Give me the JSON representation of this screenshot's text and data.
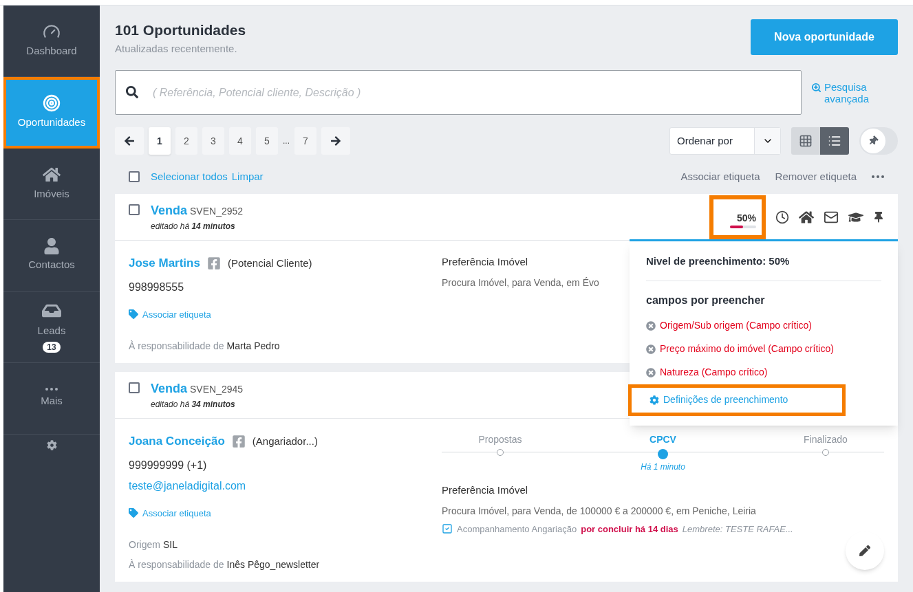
{
  "sidebar": {
    "items": [
      {
        "label": "Dashboard",
        "kind": "gauge",
        "selected": false,
        "highlighted": false
      },
      {
        "label": "Oportunidades",
        "kind": "target",
        "selected": true,
        "highlighted": true
      },
      {
        "label": "Imóveis",
        "kind": "house",
        "selected": false,
        "highlighted": false
      },
      {
        "label": "Contactos",
        "kind": "user",
        "selected": false,
        "highlighted": false
      },
      {
        "label": "Leads",
        "kind": "inbox",
        "selected": false,
        "highlighted": false,
        "badge": "13"
      },
      {
        "label": "Mais",
        "kind": "dots",
        "selected": false,
        "highlighted": false
      }
    ]
  },
  "header": {
    "title": "101 Oportunidades",
    "subtitle": "Atualizadas recentemente.",
    "new_button": "Nova oportunidade"
  },
  "search": {
    "placeholder": "( Referência, Potencial cliente, Descrição )",
    "advanced_link": "Pesquisa avançada"
  },
  "pagination": {
    "pages": [
      {
        "label": "1",
        "selected": true
      },
      {
        "label": "2",
        "selected": false
      },
      {
        "label": "3",
        "selected": false
      },
      {
        "label": "4",
        "selected": false
      },
      {
        "label": "5",
        "selected": false
      },
      {
        "label": "...",
        "kind": "ellipsis"
      },
      {
        "label": "7",
        "selected": false
      }
    ]
  },
  "sort": {
    "label": "Ordenar por"
  },
  "view": {
    "options": [
      {
        "kind": "grid",
        "selected": false
      },
      {
        "kind": "list",
        "selected": true
      }
    ]
  },
  "pin_toggle": {
    "on": false
  },
  "bulk": {
    "checked": false,
    "select_all": "Selecionar todos",
    "clear": "Limpar",
    "actions": [
      "Associar etiqueta",
      "Remover etiqueta"
    ]
  },
  "cards": [
    {
      "checked": false,
      "type": "Venda",
      "reference": "SVEN_2952",
      "edited": "editado há **14 minutos**",
      "fill": {
        "percent": "50%",
        "level": 0.5,
        "highlighted": true
      },
      "contact": {
        "name": "Jose Martins",
        "role": "(Potencial Cliente)",
        "phone": "998998555",
        "tag_link": "Associar etiqueta",
        "responsible_label": "À responsabilidade de",
        "responsible": "Marta Pedro"
      },
      "preference": {
        "title": "Preferência Imóvel",
        "text": "Procura Imóvel, para Venda, em Évo"
      }
    },
    {
      "checked": false,
      "type": "Venda",
      "reference": "SVEN_2945",
      "edited": "editado há **34 minutos**",
      "contact": {
        "name": "Joana Conceição",
        "role": "(Angariador...)",
        "phone": "999999999 (+1)",
        "email": "teste@janeladigital.com",
        "tag_link": "Associar etiqueta",
        "origin_label": "Origem",
        "origin": "SIL",
        "responsible_label": "À responsabilidade de",
        "responsible": "Inês Pêgo_newsletter"
      },
      "steps": [
        {
          "label": "Propostas",
          "selected": false
        },
        {
          "label": "CPCV",
          "selected": true,
          "time": "Há 1 minuto"
        },
        {
          "label": "Finalizado",
          "selected": false
        }
      ],
      "preference": {
        "title": "Preferência Imóvel",
        "text": "Procura Imóvel, para Venda, de 100000 € a 200000 €, em Peniche, Leiria"
      },
      "task": {
        "checked": true,
        "text": "Acompanhamento Angariação",
        "status": "por concluir há 14 dias",
        "note": "Lembrete: TESTE RAFAE..."
      }
    }
  ],
  "popover": {
    "title": "Nivel de preenchimento: 50%",
    "subtitle": "campos por preencher",
    "missing": [
      "Origem/Sub origem (Campo crítico)",
      "Preço máximo do imóvel (Campo crítico)",
      "Natureza (Campo crítico)"
    ],
    "settings_link": {
      "label": "Definições de preenchimento",
      "highlighted": true
    }
  }
}
